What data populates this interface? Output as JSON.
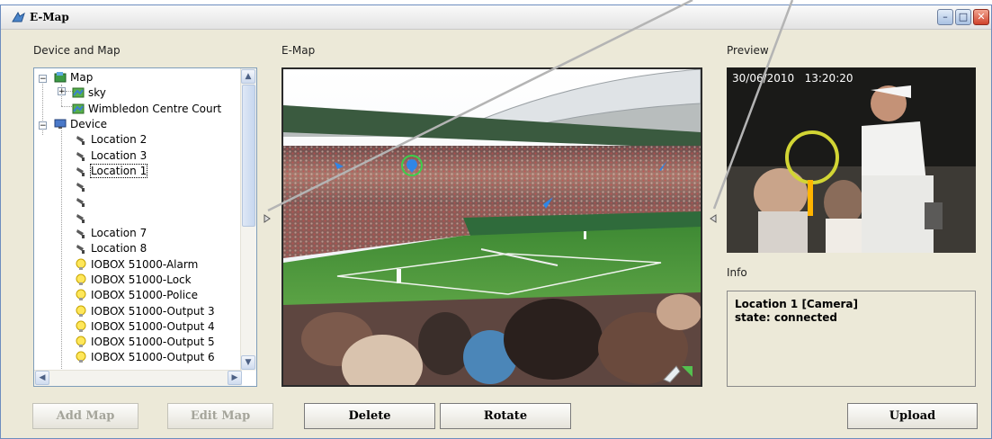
{
  "window": {
    "title": "E-Map",
    "controls": {
      "minimize": "–",
      "maximize": "□",
      "close": "✕"
    }
  },
  "labels": {
    "device_and_map": "Device and Map",
    "emap": "E-Map",
    "preview": "Preview",
    "info": "Info"
  },
  "tree": {
    "items": [
      {
        "label": "Map",
        "icon": "map-folder-icon"
      },
      {
        "label": "sky",
        "icon": "map-icon"
      },
      {
        "label": "Wimbledon Centre Court",
        "icon": "map-icon"
      },
      {
        "label": "Device",
        "icon": "monitor-icon"
      },
      {
        "label": "Location 2",
        "icon": "camera-icon"
      },
      {
        "label": "Location 3",
        "icon": "camera-icon"
      },
      {
        "label": "Location 1",
        "icon": "camera-icon",
        "selected": true
      },
      {
        "label": "",
        "icon": "camera-icon"
      },
      {
        "label": "",
        "icon": "camera-icon"
      },
      {
        "label": "",
        "icon": "camera-icon"
      },
      {
        "label": "Location 7",
        "icon": "camera-icon"
      },
      {
        "label": "Location 8",
        "icon": "camera-icon"
      },
      {
        "label": "IOBOX 51000-Alarm",
        "icon": "bulb-icon"
      },
      {
        "label": "IOBOX 51000-Lock",
        "icon": "bulb-icon"
      },
      {
        "label": "IOBOX 51000-Police",
        "icon": "bulb-icon"
      },
      {
        "label": "IOBOX 51000-Output 3",
        "icon": "bulb-icon"
      },
      {
        "label": "IOBOX 51000-Output 4",
        "icon": "bulb-icon"
      },
      {
        "label": "IOBOX 51000-Output 5",
        "icon": "bulb-icon"
      },
      {
        "label": "IOBOX 51000-Output 6",
        "icon": "bulb-icon"
      }
    ],
    "expanders": {
      "map": "−",
      "sky": "+",
      "device": "−"
    }
  },
  "preview": {
    "timestamp": "30/06/2010   13:20:20"
  },
  "info": {
    "line1": "Location 1 [Camera]",
    "line2": "state: connected"
  },
  "buttons": {
    "add_map": "Add Map",
    "edit_map": "Edit Map",
    "delete": "Delete",
    "rotate": "Rotate",
    "upload": "Upload"
  },
  "scroll": {
    "up": "▲",
    "down": "▼",
    "left": "◀",
    "right": "▶"
  },
  "colors": {
    "window_bg": "#ece9d8",
    "tree_border": "#7f9db9",
    "camera_marker": "#2f86e6",
    "selected_ring": "#3bd04b",
    "grass": "#4f9a3b"
  }
}
